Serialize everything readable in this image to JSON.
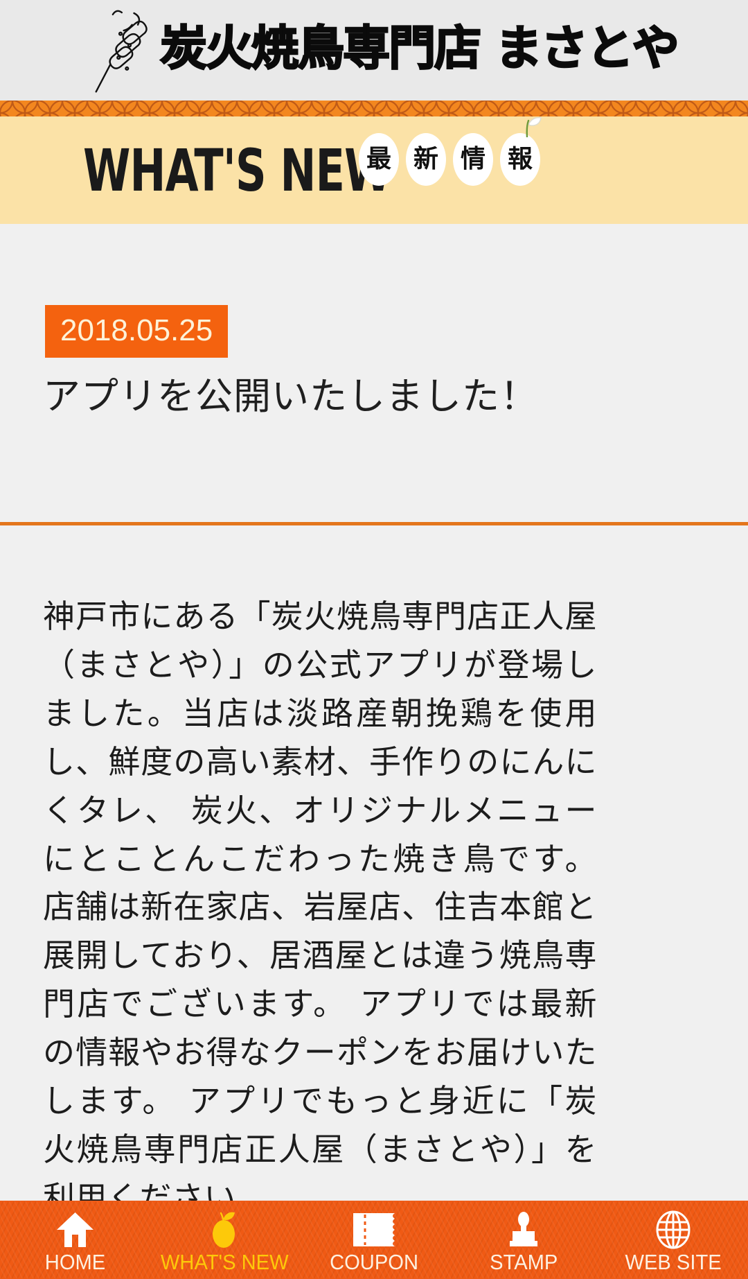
{
  "header": {
    "shop_name": "炭火焼鳥専門店 まさとや",
    "logo_icon": "yakitori-skewer-icon",
    "background_color": "#e9e9e9"
  },
  "pattern_strip": {
    "icon": "shippo-pattern",
    "color": "#f3871f",
    "line_color": "#c85a18"
  },
  "banner": {
    "title": "WHAT'S NEW",
    "background_color": "#fbe2a7",
    "kanji_bubbles": [
      {
        "char": "最"
      },
      {
        "char": "新"
      },
      {
        "char": "情"
      },
      {
        "char": "報",
        "decoration": "apple-leaf-icon"
      }
    ]
  },
  "article": {
    "date": "2018.05.25",
    "date_badge_color": "#f4620f",
    "title": "アプリを公開いたしました！",
    "divider_color": "#e4761c",
    "body": "神戸市にある「炭火焼鳥専門店正人屋（まさとや）」の公式アプリが登場しました。当店は淡路産朝挽鶏を使用し、鮮度の高い素材、手作りのにんにくタレ、 炭火、オリジナルメニューにとことんこだわった焼き鳥です。 店舗は新在家店、岩屋店、住吉本館と展開しており、居酒屋とは違う焼鳥専門店でございます。 アプリでは最新の情報やお得なクーポンをお届けいたします。 アプリでもっと身近に「炭火焼鳥専門店正人屋（まさとや）」を利用ください。"
  },
  "bottom_nav": {
    "background_color": "#f05a14",
    "active_color": "#fdc90a",
    "label_color": "#fdf1e2",
    "items": [
      {
        "label": "HOME",
        "icon": "home-icon",
        "active": false
      },
      {
        "label": "WHAT'S NEW",
        "icon": "apple-icon",
        "active": true
      },
      {
        "label": "COUPON",
        "icon": "ticket-icon",
        "active": false
      },
      {
        "label": "STAMP",
        "icon": "stamp-icon",
        "active": false
      },
      {
        "label": "WEB SITE",
        "icon": "globe-icon",
        "active": false
      }
    ]
  }
}
